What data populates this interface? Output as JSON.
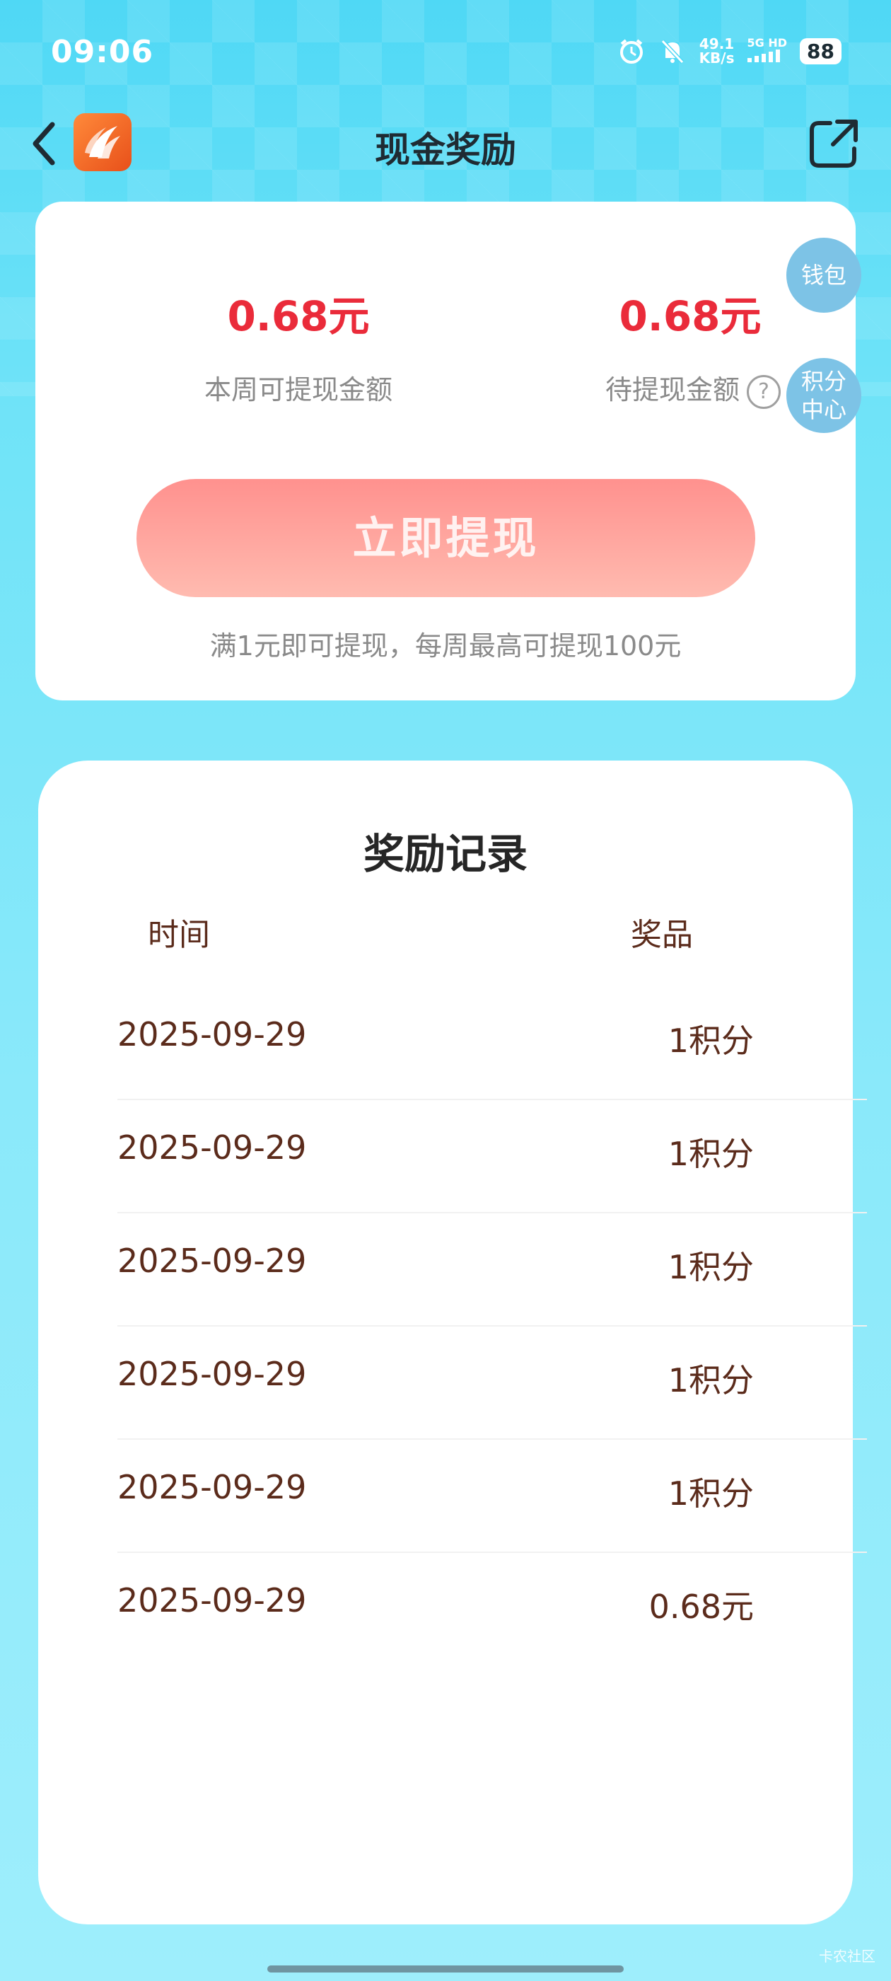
{
  "status_bar": {
    "time": "09:06",
    "net_speed": "49.1",
    "net_unit": "KB/s",
    "signal": "5G HD",
    "battery": "88"
  },
  "header": {
    "title": "现金奖励"
  },
  "summary": {
    "weekly_amount": "0.68元",
    "weekly_label": "本周可提现金额",
    "pending_amount": "0.68元",
    "pending_label": "待提现金额",
    "help_symbol": "?",
    "withdraw_button": "立即提现",
    "rule_text": "满1元即可提现，每周最高可提现100元"
  },
  "floating": {
    "wallet": "钱包",
    "points_center_line1": "积分",
    "points_center_line2": "中心"
  },
  "records": {
    "title": "奖励记录",
    "col_time": "时间",
    "col_prize": "奖品",
    "rows": [
      {
        "date": "2025-09-29",
        "prize": "1积分"
      },
      {
        "date": "2025-09-29",
        "prize": "1积分"
      },
      {
        "date": "2025-09-29",
        "prize": "1积分"
      },
      {
        "date": "2025-09-29",
        "prize": "1积分"
      },
      {
        "date": "2025-09-29",
        "prize": "1积分"
      },
      {
        "date": "2025-09-29",
        "prize": "0.68元"
      }
    ]
  },
  "watermark": "卡农社区",
  "colors": {
    "amount": "#ea2b3a",
    "record_text": "#5b2b1b",
    "bubble": "#7dc3e6"
  }
}
